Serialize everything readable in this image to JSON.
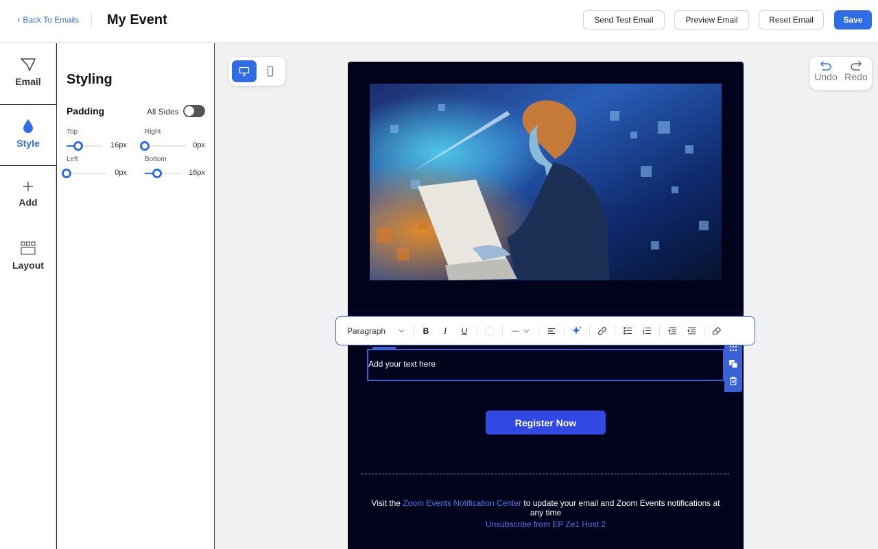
{
  "header": {
    "back_label": "Back To Emails",
    "title": "My Event",
    "buttons": {
      "send_test": "Send Test Email",
      "preview": "Preview Email",
      "reset": "Reset Email",
      "save": "Save"
    }
  },
  "sidebar": {
    "items": [
      {
        "label": "Email",
        "icon": "send-icon"
      },
      {
        "label": "Style",
        "icon": "droplet-icon",
        "active": true
      },
      {
        "label": "Add",
        "icon": "plus-icon"
      },
      {
        "label": "Layout",
        "icon": "layout-grid-icon"
      }
    ]
  },
  "styling_panel": {
    "title": "Styling",
    "padding_label": "Padding",
    "all_sides_label": "All Sides",
    "all_sides_enabled": false,
    "sliders": {
      "top": {
        "label": "Top",
        "value": "16px",
        "fraction": 0.33
      },
      "right": {
        "label": "Right",
        "value": "0px",
        "fraction": 0
      },
      "left": {
        "label": "Left",
        "value": "0px",
        "fraction": 0
      },
      "bottom": {
        "label": "Bottom",
        "value": "16px",
        "fraction": 0.33
      }
    }
  },
  "canvas": {
    "device_modes": [
      "desktop-icon",
      "mobile-icon"
    ],
    "active_device": "desktop",
    "undo_label": "Undo",
    "redo_label": "Redo"
  },
  "toolbar": {
    "block_type": "Paragraph",
    "bold": "B",
    "italic": "I",
    "underline": "U",
    "line_style": "—"
  },
  "email": {
    "text_placeholder": "Add your text here",
    "register_label": "Register Now",
    "footer": {
      "prefix": "Visit the ",
      "link": "Zoom Events Notification Center",
      "suffix": " to update your email and Zoom Events notifications at any time",
      "unsubscribe": "Unsubscribe from EP Ze1 Host 2"
    }
  },
  "colors": {
    "accent": "#2f6ce5",
    "email_bg": "#01031c",
    "register_button": "#3148e3",
    "link": "#4d7af0"
  }
}
